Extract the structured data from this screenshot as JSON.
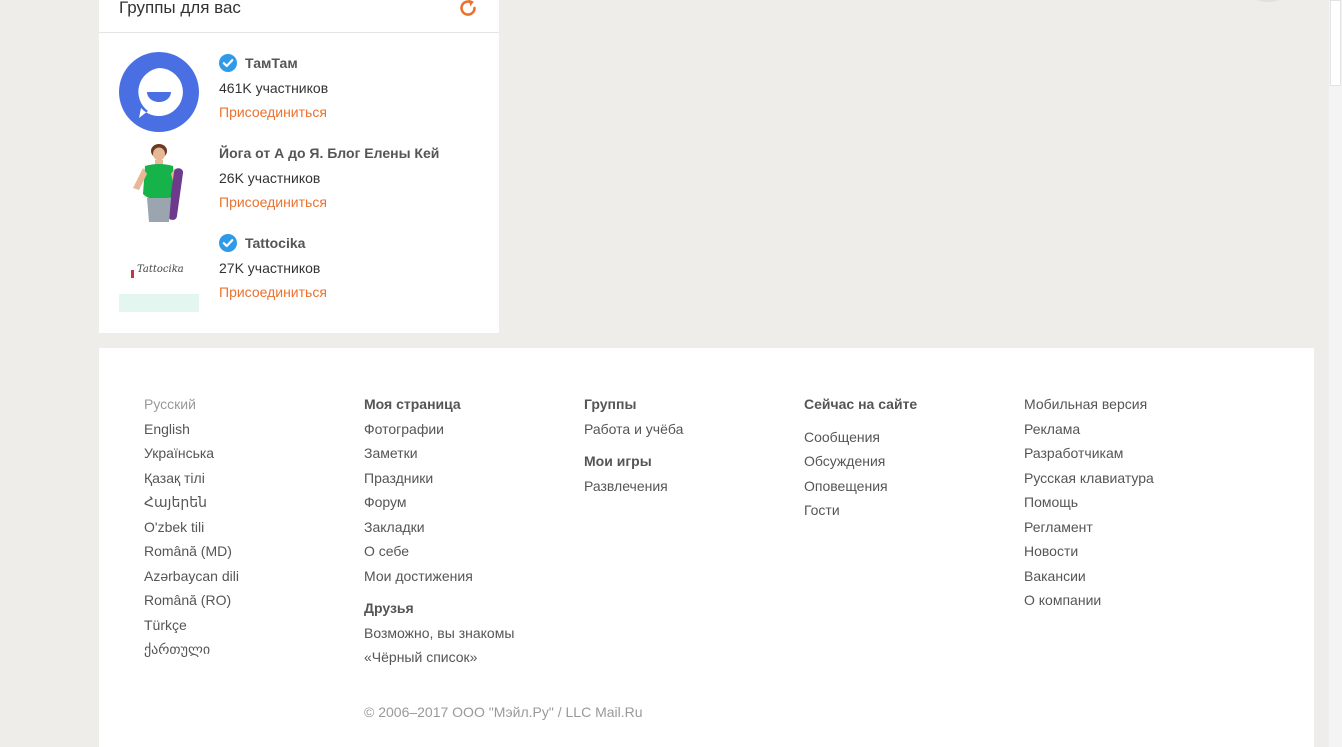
{
  "groups": {
    "title": "Группы для вас",
    "refresh_icon": "refresh-icon",
    "accent_color": "#eb722e",
    "items": [
      {
        "name": "ТамТам",
        "verified": true,
        "members": "461K участников",
        "join_label": "Присоединиться"
      },
      {
        "name": "Йога от А до Я. Блог Елены Кей",
        "verified": false,
        "members": "26K участников",
        "join_label": "Присоединиться"
      },
      {
        "name": "Tattocika",
        "verified": true,
        "members": "27K участников",
        "join_label": "Присоединиться",
        "logo_text": "Tattocika"
      }
    ]
  },
  "footer": {
    "languages": [
      "Русский",
      "English",
      "Українська",
      "Қазақ тілі",
      "Հայերեն",
      "O'zbek tili",
      "Română (MD)",
      "Azərbaycan dili",
      "Română (RO)",
      "Türkçe",
      "ქართული"
    ],
    "my_page": {
      "heading": "Моя страница",
      "links": [
        "Фотографии",
        "Заметки",
        "Праздники",
        "Форум",
        "Закладки",
        "О себе",
        "Мои достижения"
      ],
      "friends_heading": "Друзья",
      "friends_links": [
        "Возможно, вы знакомы",
        "«Чёрный список»"
      ]
    },
    "groups": {
      "heading": "Группы",
      "links": [
        "Работа и учёба"
      ],
      "games_heading": "Мои игры",
      "games_links": [
        "Развлечения"
      ]
    },
    "now_on_site": {
      "heading": "Сейчас на сайте",
      "links": [
        "Сообщения",
        "Обсуждения",
        "Оповещения",
        "Гости"
      ]
    },
    "misc": {
      "links": [
        "Мобильная версия",
        "Реклама",
        "Разработчикам",
        "Русская клавиатура",
        "Помощь",
        "Регламент",
        "Новости",
        "Вакансии",
        "О компании"
      ]
    },
    "copyright": "© 2006–2017 ООО \"Мэйл.Ру\" / LLC Mail.Ru"
  }
}
